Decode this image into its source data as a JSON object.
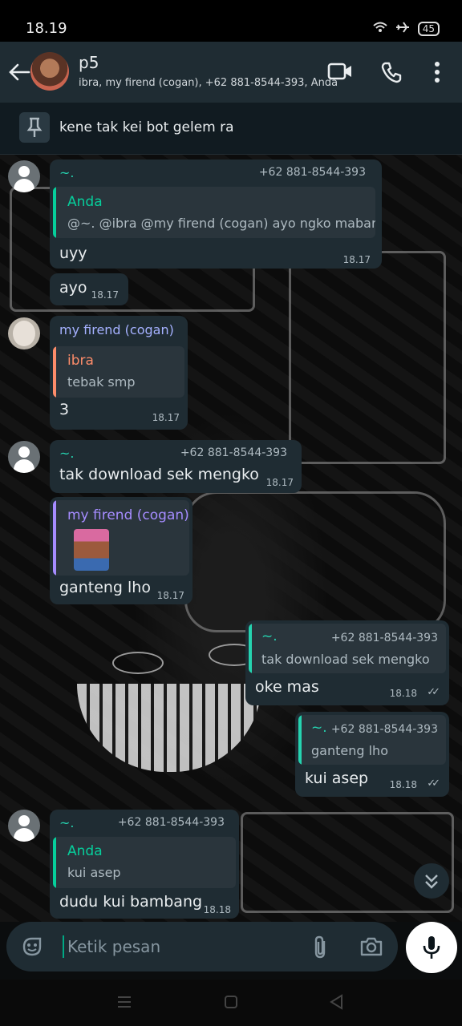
{
  "status_bar": {
    "time": "18.19",
    "battery": "45"
  },
  "header": {
    "title": "p5",
    "members": "ibra, my firend (cogan), +62 881-8544-393, Anda"
  },
  "pinned": {
    "text": "kene tak kei bot gelem ra"
  },
  "messages": [
    {
      "sender": "~.",
      "phone": "+62 881-8544-393",
      "quote_author": "Anda",
      "quote_text": "@~. @ibra @my firend (cogan) ayo ngko mabar",
      "text": "uyy",
      "time": "18.17"
    },
    {
      "text": "ayo",
      "time": "18.17"
    },
    {
      "sender": "my firend (cogan)",
      "quote_author": "ibra",
      "quote_text": "tebak smp",
      "text": "3",
      "time": "18.17"
    },
    {
      "sender": "~.",
      "phone": "+62 881-8544-393",
      "text": "tak download sek mengko",
      "time": "18.17"
    },
    {
      "quote_author": "my firend (cogan)",
      "text": "ganteng lho",
      "time": "18.17"
    },
    {
      "quote_author": "~.",
      "quote_phone": "+62 881-8544-393",
      "quote_text": "tak download sek mengko",
      "text": "oke mas",
      "time": "18.18"
    },
    {
      "quote_author": "~.",
      "quote_phone": "+62 881-8544-393",
      "quote_text": "ganteng lho",
      "text": "kui asep",
      "time": "18.18"
    },
    {
      "sender": "~.",
      "phone": "+62 881-8544-393",
      "quote_author": "Anda",
      "quote_text": "kui asep",
      "text": "dudu kui bambang",
      "time": "18.18"
    }
  ],
  "composer": {
    "placeholder": "Ketik pesan"
  },
  "colors": {
    "accent": "#00a884",
    "header_bg": "#1f2c33",
    "bubble_bg": "#1f2c33",
    "quote_anda": "#06cf9c",
    "quote_ibra": "#fc8c6a",
    "sender_cogan": "#a5b1ff",
    "quote_cogan": "#a58cff",
    "quote_tilde": "#25d3b0"
  },
  "icons": [
    "back-arrow-icon",
    "video-call-icon",
    "voice-call-icon",
    "more-options-icon",
    "pin-icon",
    "sticker-icon",
    "attach-icon",
    "camera-icon",
    "microphone-icon",
    "double-check-icon",
    "chevron-down-icon"
  ]
}
